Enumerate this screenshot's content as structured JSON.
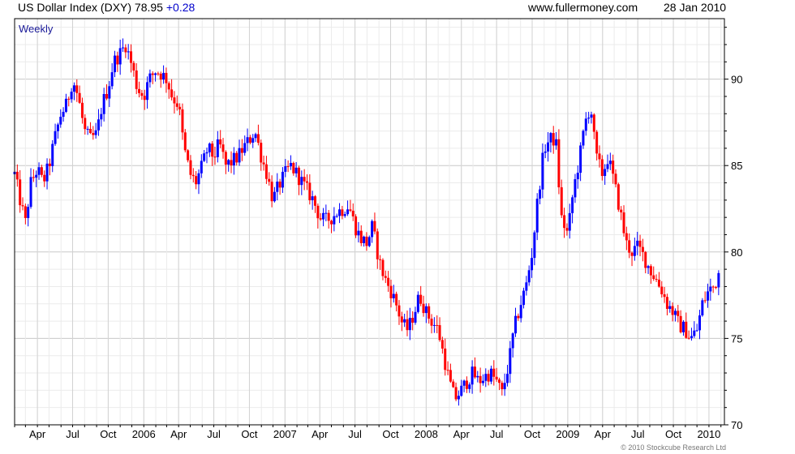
{
  "header": {
    "instrument": "US Dollar Index (DXY) 78.95",
    "change": "+0.28",
    "website": "www.fullermoney.com",
    "date": "28 Jan 2010"
  },
  "colors": {
    "up": "#0000ff",
    "down": "#ff0000",
    "grid": "#d9d9d9",
    "frame": "#000000",
    "period_label": "#1a1a99"
  },
  "chart_data": {
    "type": "candlestick",
    "title": "US Dollar Index (DXY)",
    "period_label": "Weekly",
    "ylim": [
      70,
      93.5
    ],
    "y_ticks": [
      70,
      75,
      80,
      85,
      90
    ],
    "x_ticks": [
      {
        "date": "2005-04-01",
        "label": "Apr"
      },
      {
        "date": "2005-07-01",
        "label": "Jul"
      },
      {
        "date": "2005-10-01",
        "label": "Oct"
      },
      {
        "date": "2006-01-01",
        "label": "2006"
      },
      {
        "date": "2006-04-01",
        "label": "Apr"
      },
      {
        "date": "2006-07-01",
        "label": "Jul"
      },
      {
        "date": "2006-10-01",
        "label": "Oct"
      },
      {
        "date": "2007-01-01",
        "label": "2007"
      },
      {
        "date": "2007-04-01",
        "label": "Apr"
      },
      {
        "date": "2007-07-01",
        "label": "Jul"
      },
      {
        "date": "2007-10-01",
        "label": "Oct"
      },
      {
        "date": "2008-01-01",
        "label": "2008"
      },
      {
        "date": "2008-04-01",
        "label": "Apr"
      },
      {
        "date": "2008-07-01",
        "label": "Jul"
      },
      {
        "date": "2008-10-01",
        "label": "Oct"
      },
      {
        "date": "2009-01-01",
        "label": "2009"
      },
      {
        "date": "2009-04-01",
        "label": "Apr"
      },
      {
        "date": "2009-07-01",
        "label": "Jul"
      },
      {
        "date": "2009-10-01",
        "label": "Oct"
      },
      {
        "date": "2010-01-01",
        "label": "2010"
      }
    ],
    "x_range": [
      "2005-02-01",
      "2010-02-10"
    ],
    "close_path": [
      [
        "2005-02-01",
        84.5
      ],
      [
        "2005-02-15",
        83.0
      ],
      [
        "2005-03-01",
        81.7
      ],
      [
        "2005-03-15",
        84.0
      ],
      [
        "2005-04-01",
        84.8
      ],
      [
        "2005-04-15",
        84.0
      ],
      [
        "2005-05-01",
        85.0
      ],
      [
        "2005-05-15",
        86.5
      ],
      [
        "2005-06-01",
        88.0
      ],
      [
        "2005-06-15",
        88.5
      ],
      [
        "2005-07-01",
        90.0
      ],
      [
        "2005-07-15",
        89.0
      ],
      [
        "2005-08-01",
        87.0
      ],
      [
        "2005-08-15",
        86.5
      ],
      [
        "2005-09-01",
        86.8
      ],
      [
        "2005-09-15",
        88.5
      ],
      [
        "2005-10-01",
        89.5
      ],
      [
        "2005-10-15",
        91.0
      ],
      [
        "2005-11-01",
        91.5
      ],
      [
        "2005-11-15",
        92.0
      ],
      [
        "2005-12-01",
        90.8
      ],
      [
        "2005-12-15",
        89.5
      ],
      [
        "2006-01-01",
        89.0
      ],
      [
        "2006-01-15",
        90.0
      ],
      [
        "2006-02-01",
        90.5
      ],
      [
        "2006-02-15",
        90.3
      ],
      [
        "2006-03-01",
        90.0
      ],
      [
        "2006-03-15",
        89.0
      ],
      [
        "2006-04-01",
        88.5
      ],
      [
        "2006-04-15",
        86.0
      ],
      [
        "2006-05-01",
        84.5
      ],
      [
        "2006-05-15",
        84.0
      ],
      [
        "2006-06-01",
        85.0
      ],
      [
        "2006-06-15",
        86.0
      ],
      [
        "2006-07-01",
        85.5
      ],
      [
        "2006-07-15",
        86.3
      ],
      [
        "2006-08-01",
        85.0
      ],
      [
        "2006-08-15",
        85.2
      ],
      [
        "2006-09-01",
        85.5
      ],
      [
        "2006-09-15",
        86.0
      ],
      [
        "2006-10-01",
        86.5
      ],
      [
        "2006-10-15",
        87.0
      ],
      [
        "2006-11-01",
        85.5
      ],
      [
        "2006-11-15",
        84.5
      ],
      [
        "2006-12-01",
        83.0
      ],
      [
        "2006-12-15",
        83.8
      ],
      [
        "2007-01-01",
        84.5
      ],
      [
        "2007-01-15",
        85.0
      ],
      [
        "2007-02-01",
        84.5
      ],
      [
        "2007-02-15",
        84.0
      ],
      [
        "2007-03-01",
        83.5
      ],
      [
        "2007-03-15",
        83.0
      ],
      [
        "2007-04-01",
        82.0
      ],
      [
        "2007-04-15",
        81.8
      ],
      [
        "2007-05-01",
        82.0
      ],
      [
        "2007-05-15",
        82.3
      ],
      [
        "2007-06-01",
        82.5
      ],
      [
        "2007-06-15",
        82.7
      ],
      [
        "2007-07-01",
        81.5
      ],
      [
        "2007-07-15",
        80.8
      ],
      [
        "2007-08-01",
        80.5
      ],
      [
        "2007-08-15",
        81.5
      ],
      [
        "2007-09-01",
        79.5
      ],
      [
        "2007-09-15",
        78.5
      ],
      [
        "2007-10-01",
        77.8
      ],
      [
        "2007-10-15",
        77.0
      ],
      [
        "2007-11-01",
        75.8
      ],
      [
        "2007-11-15",
        75.5
      ],
      [
        "2007-12-01",
        76.5
      ],
      [
        "2007-12-15",
        77.5
      ],
      [
        "2008-01-01",
        76.5
      ],
      [
        "2008-01-15",
        76.0
      ],
      [
        "2008-02-01",
        75.5
      ],
      [
        "2008-02-15",
        74.0
      ],
      [
        "2008-03-01",
        72.5
      ],
      [
        "2008-03-15",
        71.5
      ],
      [
        "2008-04-01",
        72.0
      ],
      [
        "2008-04-15",
        72.5
      ],
      [
        "2008-05-01",
        73.0
      ],
      [
        "2008-05-15",
        72.5
      ],
      [
        "2008-06-01",
        72.8
      ],
      [
        "2008-06-15",
        73.0
      ],
      [
        "2008-07-01",
        72.5
      ],
      [
        "2008-07-15",
        71.8
      ],
      [
        "2008-08-01",
        73.5
      ],
      [
        "2008-08-15",
        75.5
      ],
      [
        "2008-09-01",
        77.0
      ],
      [
        "2008-09-15",
        78.0
      ],
      [
        "2008-10-01",
        80.0
      ],
      [
        "2008-10-15",
        83.0
      ],
      [
        "2008-11-01",
        86.0
      ],
      [
        "2008-11-15",
        86.5
      ],
      [
        "2008-12-01",
        86.5
      ],
      [
        "2008-12-15",
        82.0
      ],
      [
        "2009-01-01",
        81.0
      ],
      [
        "2009-01-15",
        83.5
      ],
      [
        "2009-02-01",
        85.5
      ],
      [
        "2009-02-15",
        87.5
      ],
      [
        "2009-03-01",
        88.5
      ],
      [
        "2009-03-15",
        85.5
      ],
      [
        "2009-04-01",
        84.5
      ],
      [
        "2009-04-15",
        85.5
      ],
      [
        "2009-05-01",
        84.0
      ],
      [
        "2009-05-15",
        82.5
      ],
      [
        "2009-06-01",
        80.5
      ],
      [
        "2009-06-15",
        80.0
      ],
      [
        "2009-07-01",
        80.3
      ],
      [
        "2009-07-15",
        79.8
      ],
      [
        "2009-08-01",
        79.0
      ],
      [
        "2009-08-15",
        78.5
      ],
      [
        "2009-09-01",
        77.8
      ],
      [
        "2009-09-15",
        77.0
      ],
      [
        "2009-10-01",
        76.5
      ],
      [
        "2009-10-15",
        75.8
      ],
      [
        "2009-11-01",
        75.5
      ],
      [
        "2009-11-15",
        75.0
      ],
      [
        "2009-12-01",
        75.5
      ],
      [
        "2009-12-15",
        77.0
      ],
      [
        "2010-01-01",
        77.8
      ],
      [
        "2010-01-15",
        78.0
      ],
      [
        "2010-01-28",
        78.95
      ]
    ],
    "last_close": 78.95,
    "grid": true,
    "y_axis_side": "right"
  },
  "footer": {
    "copyright": "© 2010 Stockcube Research Ltd"
  }
}
